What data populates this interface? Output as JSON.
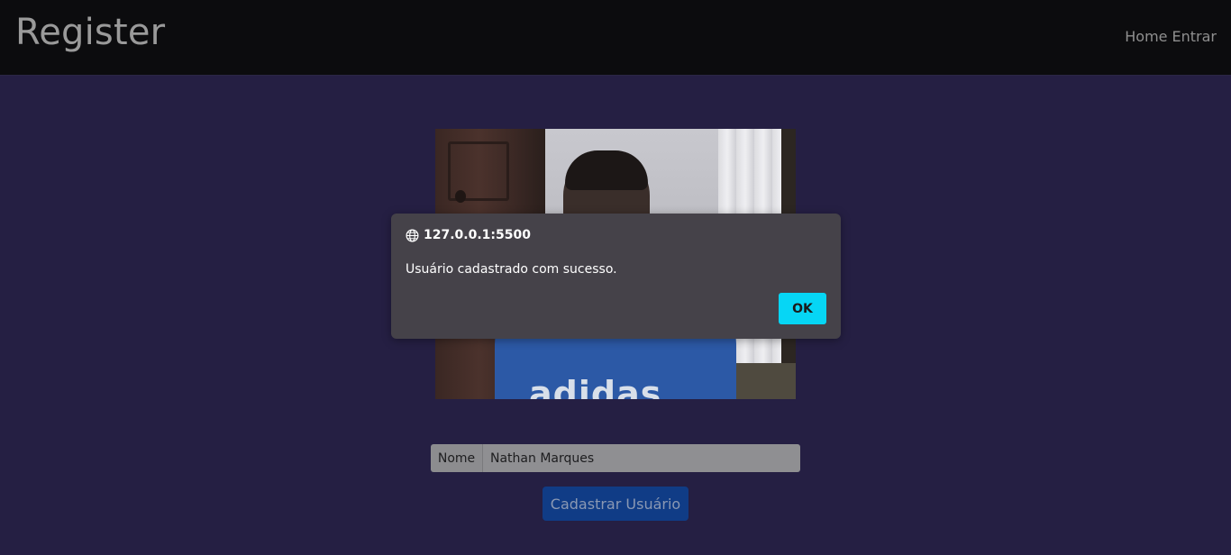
{
  "navbar": {
    "brand": "Register",
    "links": [
      "Home",
      "Entrar"
    ]
  },
  "dialog": {
    "origin": "127.0.0.1:5500",
    "origin_icon": "globe-icon",
    "message": "Usuário cadastrado com sucesso.",
    "ok_label": "OK",
    "ok_color": "#06d6f5"
  },
  "form": {
    "name_label": "Nome",
    "name_value": "Nathan Marques",
    "submit_label": "Cadastrar Usuário"
  },
  "camera": {
    "shirt_text": "adidas"
  },
  "colors": {
    "page_background": "#251f43",
    "navbar_background": "#0c0c0e",
    "submit_button": "#103c86"
  }
}
